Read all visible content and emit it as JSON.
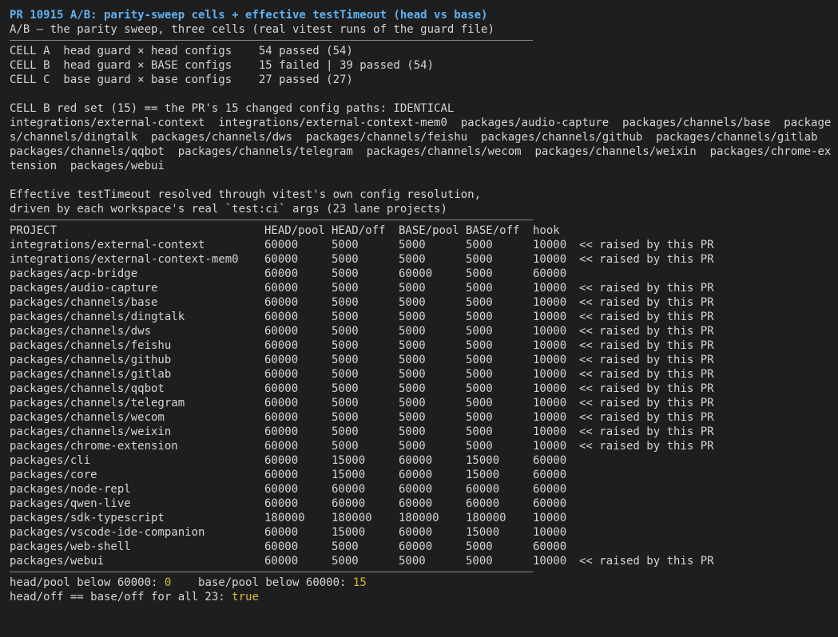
{
  "title": "PR 10915 A/B: parity-sweep cells + effective testTimeout (head vs base)",
  "subtitle": "A/B — the parity sweep, three cells (real vitest runs of the guard file)",
  "cells": [
    "CELL A  head guard × head configs    54 passed (54)",
    "CELL B  head guard × BASE configs    15 failed | 39 passed (54)",
    "CELL C  base guard × base configs    27 passed (27)"
  ],
  "red_set": {
    "header": "CELL B red set (15) == the PR's 15 changed config paths: IDENTICAL",
    "lines": [
      "integrations/external-context  integrations/external-context-mem0  packages/audio-capture  packages/channels/base  package",
      "s/channels/dingtalk  packages/channels/dws  packages/channels/feishu  packages/channels/github  packages/channels/gitlab",
      "packages/channels/qqbot  packages/channels/telegram  packages/channels/wecom  packages/channels/weixin  packages/chrome-ex",
      "tension  packages/webui"
    ]
  },
  "effective": [
    "Effective testTimeout resolved through vitest's own config resolution,",
    "driven by each workspace's real `test:ci` args (23 lane projects)"
  ],
  "table": {
    "headers": [
      "PROJECT",
      "HEAD/pool",
      "HEAD/off",
      "BASE/pool",
      "BASE/off",
      "hook",
      ""
    ],
    "rows": [
      [
        "integrations/external-context",
        "60000",
        "5000",
        "5000",
        "5000",
        "10000",
        "<< raised by this PR"
      ],
      [
        "integrations/external-context-mem0",
        "60000",
        "5000",
        "5000",
        "5000",
        "10000",
        "<< raised by this PR"
      ],
      [
        "packages/acp-bridge",
        "60000",
        "5000",
        "60000",
        "5000",
        "60000",
        ""
      ],
      [
        "packages/audio-capture",
        "60000",
        "5000",
        "5000",
        "5000",
        "10000",
        "<< raised by this PR"
      ],
      [
        "packages/channels/base",
        "60000",
        "5000",
        "5000",
        "5000",
        "10000",
        "<< raised by this PR"
      ],
      [
        "packages/channels/dingtalk",
        "60000",
        "5000",
        "5000",
        "5000",
        "10000",
        "<< raised by this PR"
      ],
      [
        "packages/channels/dws",
        "60000",
        "5000",
        "5000",
        "5000",
        "10000",
        "<< raised by this PR"
      ],
      [
        "packages/channels/feishu",
        "60000",
        "5000",
        "5000",
        "5000",
        "10000",
        "<< raised by this PR"
      ],
      [
        "packages/channels/github",
        "60000",
        "5000",
        "5000",
        "5000",
        "10000",
        "<< raised by this PR"
      ],
      [
        "packages/channels/gitlab",
        "60000",
        "5000",
        "5000",
        "5000",
        "10000",
        "<< raised by this PR"
      ],
      [
        "packages/channels/qqbot",
        "60000",
        "5000",
        "5000",
        "5000",
        "10000",
        "<< raised by this PR"
      ],
      [
        "packages/channels/telegram",
        "60000",
        "5000",
        "5000",
        "5000",
        "10000",
        "<< raised by this PR"
      ],
      [
        "packages/channels/wecom",
        "60000",
        "5000",
        "5000",
        "5000",
        "10000",
        "<< raised by this PR"
      ],
      [
        "packages/channels/weixin",
        "60000",
        "5000",
        "5000",
        "5000",
        "10000",
        "<< raised by this PR"
      ],
      [
        "packages/chrome-extension",
        "60000",
        "5000",
        "5000",
        "5000",
        "10000",
        "<< raised by this PR"
      ],
      [
        "packages/cli",
        "60000",
        "15000",
        "60000",
        "15000",
        "60000",
        ""
      ],
      [
        "packages/core",
        "60000",
        "15000",
        "60000",
        "15000",
        "60000",
        ""
      ],
      [
        "packages/node-repl",
        "60000",
        "60000",
        "60000",
        "60000",
        "60000",
        ""
      ],
      [
        "packages/qwen-live",
        "60000",
        "60000",
        "60000",
        "60000",
        "60000",
        ""
      ],
      [
        "packages/sdk-typescript",
        "180000",
        "180000",
        "180000",
        "180000",
        "10000",
        ""
      ],
      [
        "packages/vscode-ide-companion",
        "60000",
        "15000",
        "60000",
        "15000",
        "10000",
        ""
      ],
      [
        "packages/web-shell",
        "60000",
        "5000",
        "60000",
        "5000",
        "60000",
        ""
      ],
      [
        "packages/webui",
        "60000",
        "5000",
        "5000",
        "5000",
        "10000",
        "<< raised by this PR"
      ]
    ]
  },
  "summary": {
    "head_pool_label": "head/pool below 60000: ",
    "head_pool_value": "0",
    "base_pool_label": "    base/pool below 60000: ",
    "base_pool_value": "15",
    "off_label": "head/off == base/off for all 23: ",
    "off_value": "true"
  },
  "colors": {
    "title": "#5fb3f4",
    "highlight": "#d7ba3b",
    "background": "#1e1e1e",
    "text": "#d4d4d4"
  }
}
